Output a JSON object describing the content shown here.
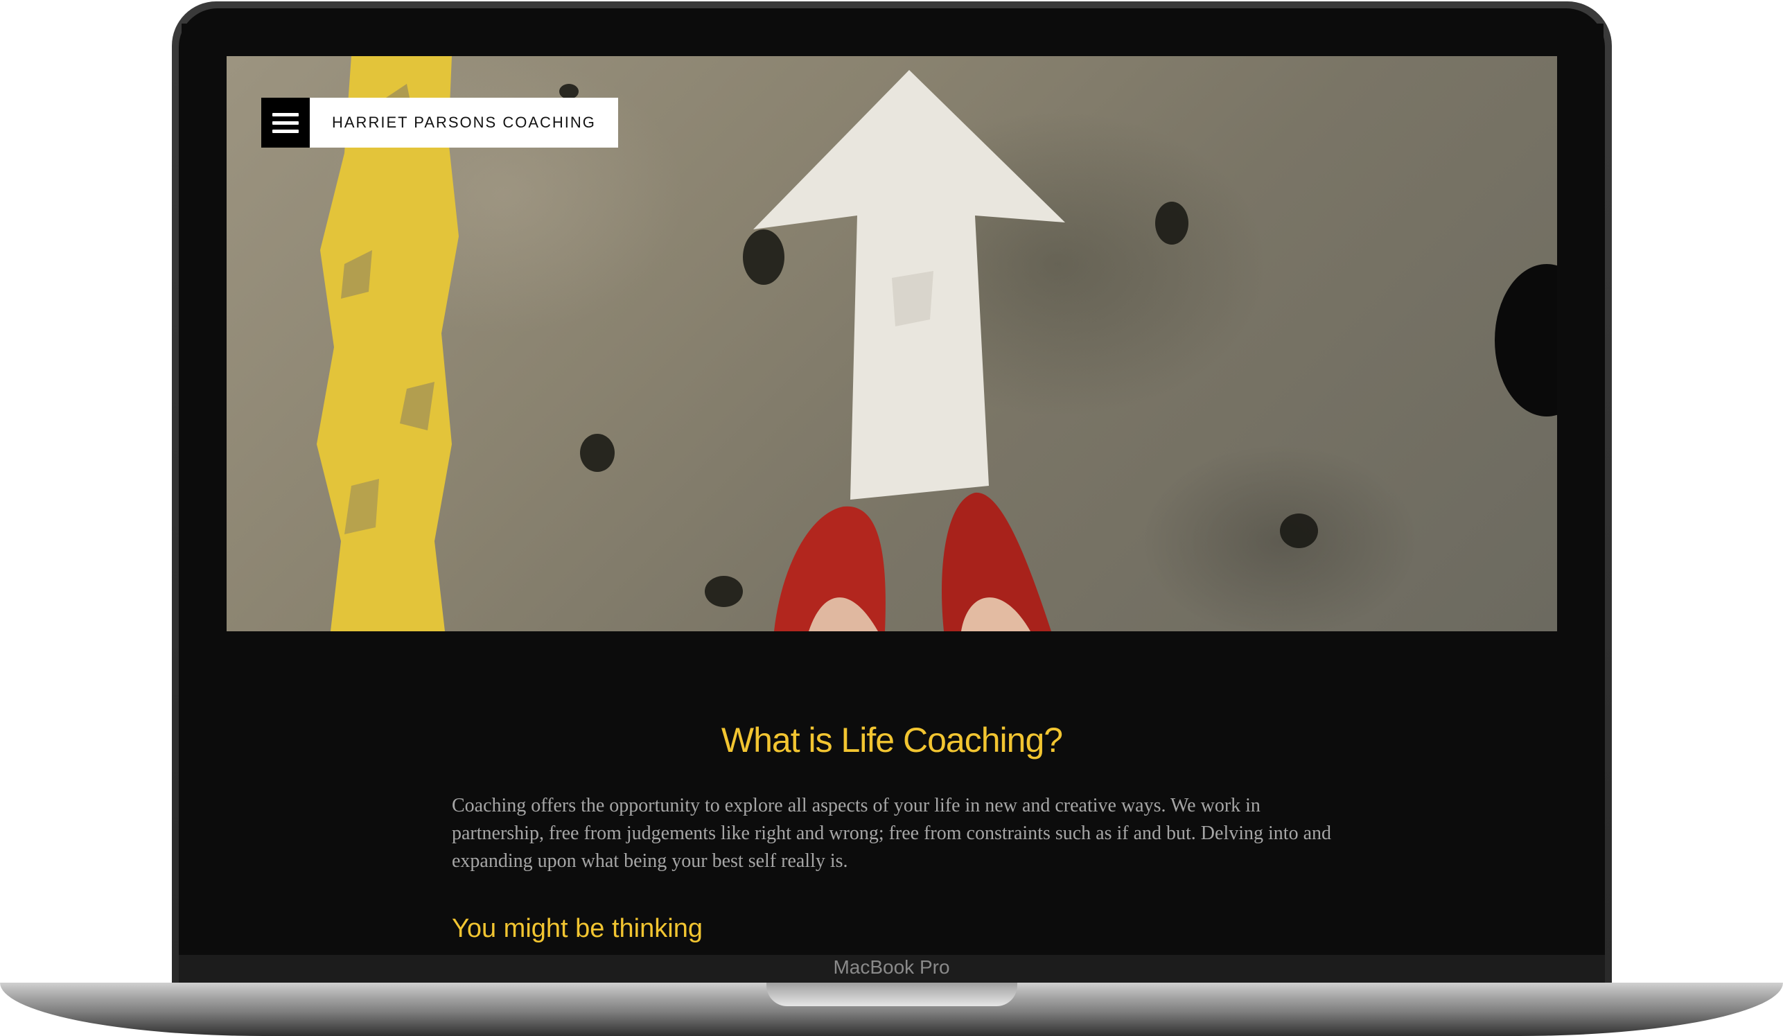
{
  "device": {
    "label": "MacBook Pro"
  },
  "header": {
    "brand": "HARRIET PARSONS COACHING",
    "menu_icon": "hamburger-menu-icon"
  },
  "hero": {
    "image": "arrow-on-pavement-red-shoes"
  },
  "main": {
    "title": "What is Life Coaching?",
    "paragraph": "Coaching offers the opportunity to explore all aspects of your life in new and creative ways. We work in partnership, free from judgements like right and wrong; free from constraints such as if and but. Delving into and expanding upon what being your best self really is.",
    "subheading": "You might be thinking"
  },
  "colors": {
    "accent": "#f2c531",
    "background": "#0c0c0c",
    "body_text": "#a6a6a6"
  }
}
